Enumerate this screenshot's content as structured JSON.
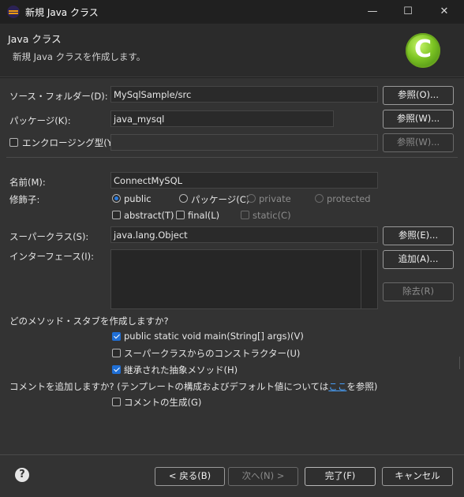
{
  "window": {
    "title": "新規 Java クラス",
    "minimize_label": "—",
    "maximize_label": "☐",
    "close_label": "✕"
  },
  "header": {
    "title": "Java クラス",
    "description": "新規 Java クラスを作成します。",
    "logo_letter": "C"
  },
  "source_folder": {
    "label": "ソース・フォルダー(D):",
    "value": "MySqlSample/src",
    "browse_label": "参照(O)..."
  },
  "package": {
    "label": "パッケージ(K):",
    "value": "java_mysql",
    "browse_label": "参照(W)..."
  },
  "enclosing": {
    "label": "エンクロージング型(Y):",
    "checked": false,
    "value": "",
    "browse_label": "参照(W)..."
  },
  "name": {
    "label": "名前(M):",
    "value": "ConnectMySQL"
  },
  "modifiers": {
    "label": "修飾子:",
    "radios": [
      {
        "label": "public",
        "selected": true,
        "enabled": true
      },
      {
        "label": "パッケージ(C)",
        "selected": false,
        "enabled": true
      },
      {
        "label": "private",
        "selected": false,
        "enabled": false
      },
      {
        "label": "protected",
        "selected": false,
        "enabled": false
      }
    ],
    "checks": [
      {
        "label": "abstract(T)",
        "checked": false,
        "enabled": true
      },
      {
        "label": "final(L)",
        "checked": false,
        "enabled": true
      },
      {
        "label": "static(C)",
        "checked": false,
        "enabled": false
      }
    ]
  },
  "superclass": {
    "label": "スーパークラス(S):",
    "value": "java.lang.Object",
    "browse_label": "参照(E)..."
  },
  "interfaces": {
    "label": "インターフェース(I):",
    "add_label": "追加(A)...",
    "remove_label": "除去(R)",
    "items": []
  },
  "stubs": {
    "question": "どのメソッド・スタブを作成しますか?",
    "options": [
      {
        "label": "public static void main(String[] args)(V)",
        "checked": true
      },
      {
        "label": "スーパークラスからのコンストラクター(U)",
        "checked": false
      },
      {
        "label": "継承された抽象メソッド(H)",
        "checked": true
      }
    ]
  },
  "comments": {
    "question_prefix": "コメントを追加しますか? (テンプレートの構成およびデフォルト値については",
    "link_text": "ここ",
    "question_suffix": "を参照)",
    "option_label": "コメントの生成(G)",
    "checked": false
  },
  "footer": {
    "help_label": "?",
    "back_label": "< 戻る(B)",
    "next_label": "次へ(N) >",
    "finish_label": "完了(F)",
    "cancel_label": "キャンセル"
  }
}
